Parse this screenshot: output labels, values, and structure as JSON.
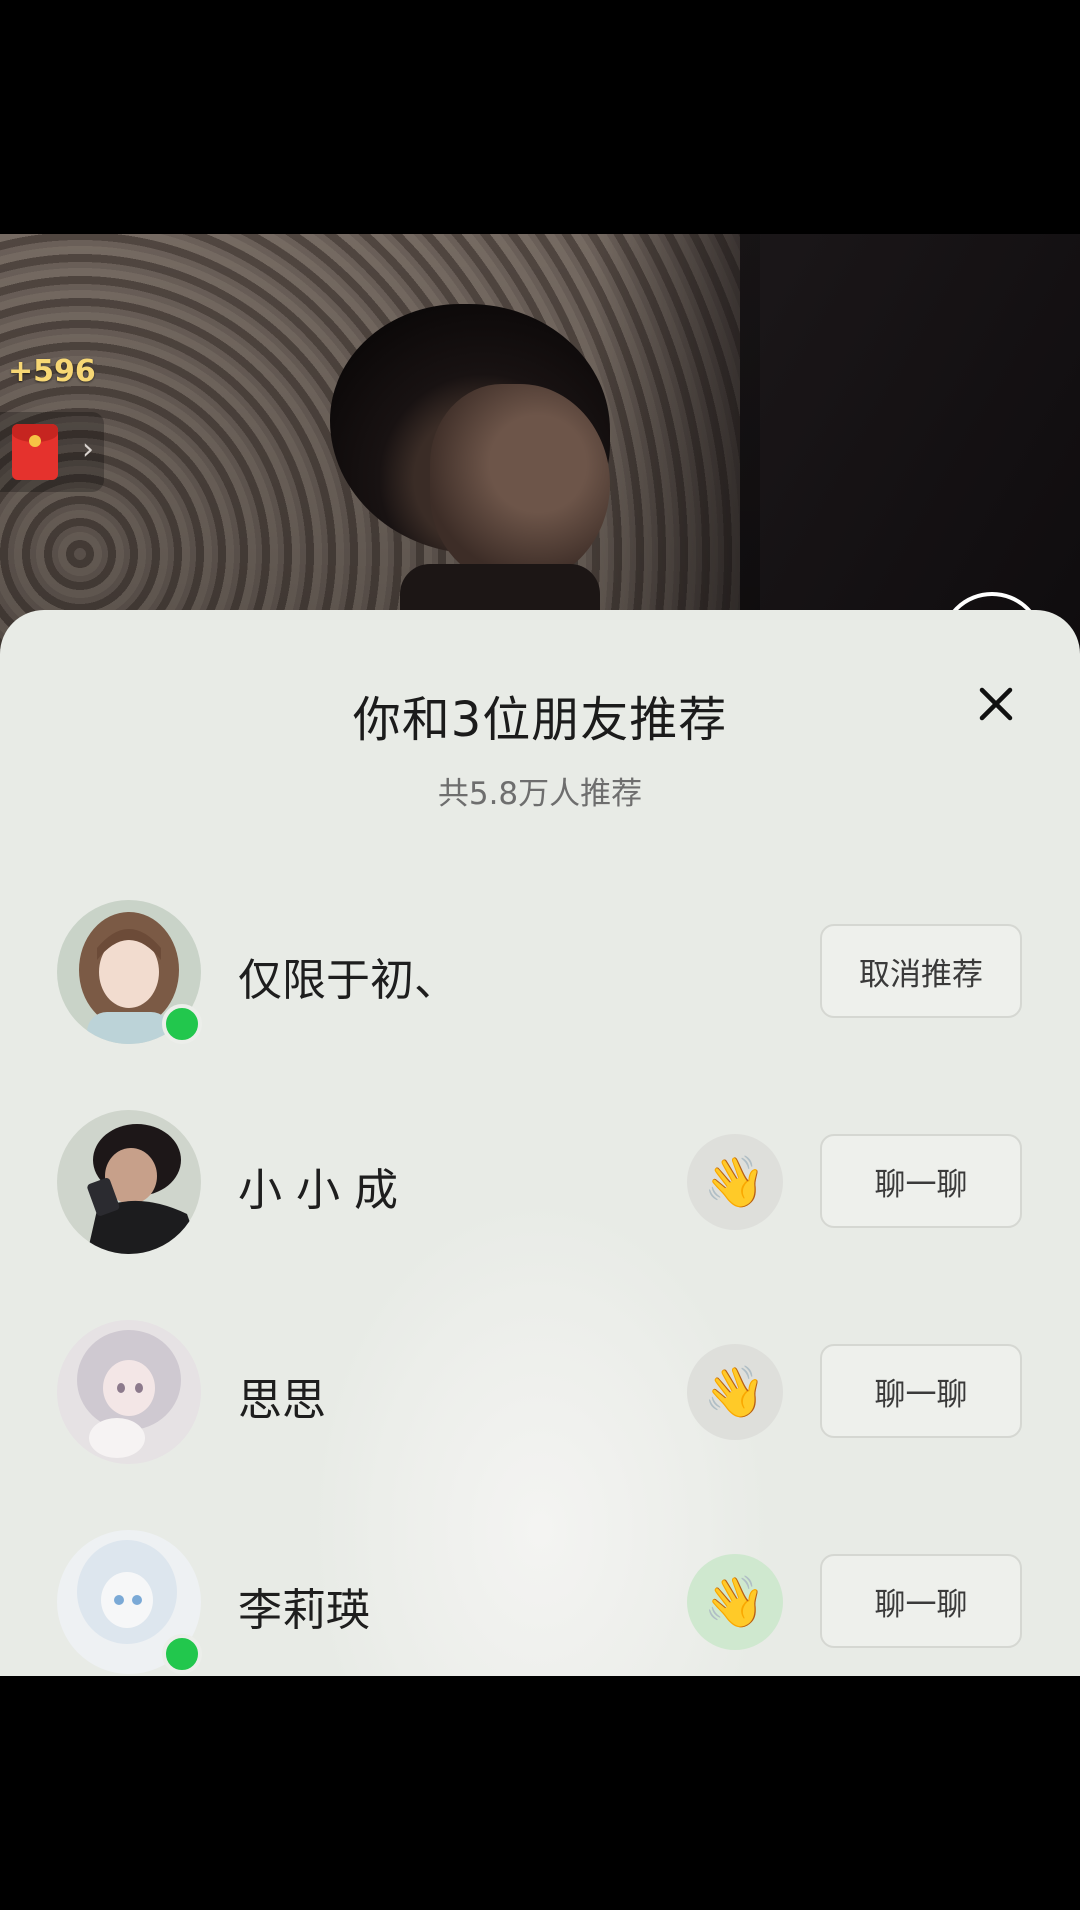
{
  "stream": {
    "coin_gain": "+596",
    "red_packet_icon": "red-packet-icon",
    "chevron": "›"
  },
  "sheet": {
    "title": "你和3位朋友推荐",
    "subtitle": "共5.8万人推荐",
    "close_glyph": "×"
  },
  "friends": [
    {
      "name": "仅限于初、",
      "online": true,
      "action": "取消推荐",
      "wave": false
    },
    {
      "name": "小 小 成",
      "online": false,
      "action": "聊一聊",
      "wave": true
    },
    {
      "name": "思思",
      "online": false,
      "action": "聊一聊",
      "wave": true
    },
    {
      "name": "李莉瑛",
      "online": true,
      "action": "聊一聊",
      "wave": true
    }
  ],
  "colors": {
    "online_dot": "#22c74d",
    "coin_text": "#f7d774",
    "sheet_bg": "#eceeea"
  }
}
